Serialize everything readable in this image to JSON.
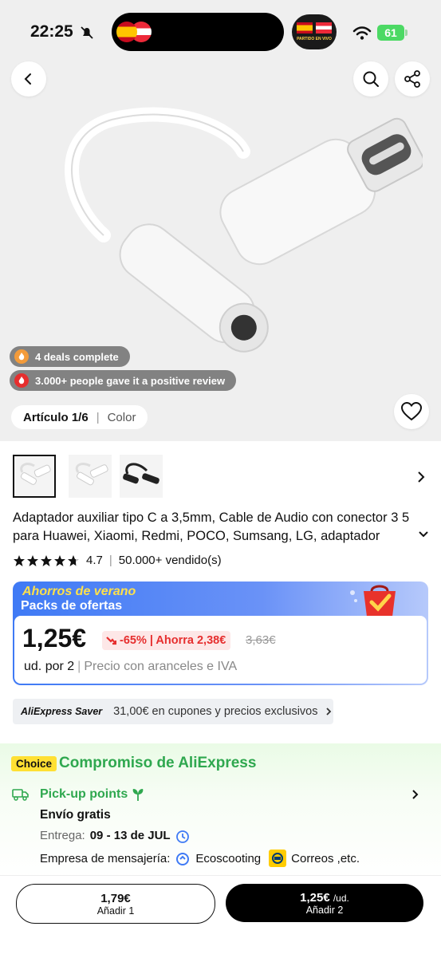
{
  "status_bar": {
    "time": "22:25",
    "battery": "61",
    "live_badge_text": "PARTIDO EN VIVO"
  },
  "product": {
    "deals_chip": "4 deals complete",
    "reviews_chip": "3.000+ people gave it a positive review",
    "article_label": "Artículo 1/6",
    "article_sep": "|",
    "color_label": "Color",
    "title": "Adaptador auxiliar tipo C a 3,5mm, Cable de Audio con conector 3 5 para Huawei, Xiaomi, Redmi, POCO, Sumsang, LG, adaptador",
    "rating": "4.7",
    "sold": "50.000+ vendido(s)",
    "rating_sep": "|"
  },
  "promo": {
    "title": "Ahorros de verano",
    "subtitle": "Packs de ofertas",
    "price": "1,25€",
    "discount": "-65% | Ahorra 2,38€",
    "old_price": "3,63€",
    "unit": "ud. por 2",
    "tax_note": "Precio con aranceles e IVA",
    "tax_sep": "|"
  },
  "saver": {
    "brand": "AliExpress Saver",
    "text": "31,00€ en cupones y precios exclusivos"
  },
  "choice": {
    "badge": "Choice",
    "title": "Compromiso de AliExpress",
    "pickup": "Pick-up points",
    "shipping": "Envío gratis",
    "delivery_label": "Entrega:",
    "delivery_dates": "09 - 13 de JUL",
    "courier_label": "Empresa de mensajería:",
    "courier1": "Ecoscooting",
    "courier2": "Correos ,etc."
  },
  "bottom": {
    "btn1_price": "1,79€",
    "btn1_label": "Añadir 1",
    "btn2_price": "1,25€",
    "btn2_unit": "/ud.",
    "btn2_label": "Añadir 2"
  },
  "colors": {
    "accent_red": "#e62e2e",
    "choice_green": "#2fa84f",
    "promo_blue": "#3f7af5",
    "battery_green": "#4cd964"
  }
}
